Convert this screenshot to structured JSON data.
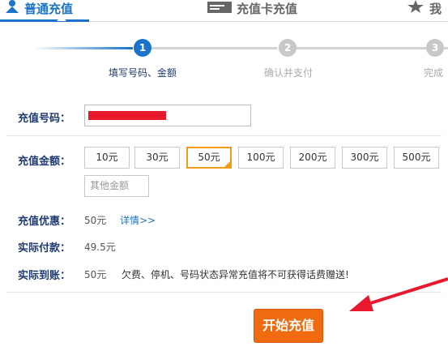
{
  "tabs": [
    {
      "label": "普通充值",
      "icon": "user-icon",
      "active": true
    },
    {
      "label": "充值卡充值",
      "icon": "card-icon",
      "active": false
    },
    {
      "label": "我",
      "icon": "star-icon",
      "active": false
    }
  ],
  "steps": [
    {
      "num": "1",
      "label": "填写号码、金额",
      "status": "current"
    },
    {
      "num": "2",
      "label": "确认并支付",
      "status": "pending"
    },
    {
      "num": "3",
      "label": "完成",
      "status": "pending"
    }
  ],
  "form": {
    "phone_label": "充值号码：",
    "amount_label": "充值金额：",
    "amounts": [
      "10元",
      "30元",
      "50元",
      "100元",
      "200元",
      "300元",
      "500元"
    ],
    "selected_amount": "50元",
    "other_placeholder": "其他金额",
    "discount_label": "充值优惠：",
    "discount_value": "50元",
    "discount_link": "详情>>",
    "pay_label": "实际付款：",
    "pay_value": "49.5元",
    "receive_label": "实际到账：",
    "receive_value": "50元",
    "receive_note": "欠费、停机、号码状态异常充值将不可获得话费赠送!"
  },
  "submit_label": "开始充值",
  "colors": {
    "accent": "#1a73c8",
    "orange": "#f06a10",
    "arrow": "#e8192c"
  }
}
